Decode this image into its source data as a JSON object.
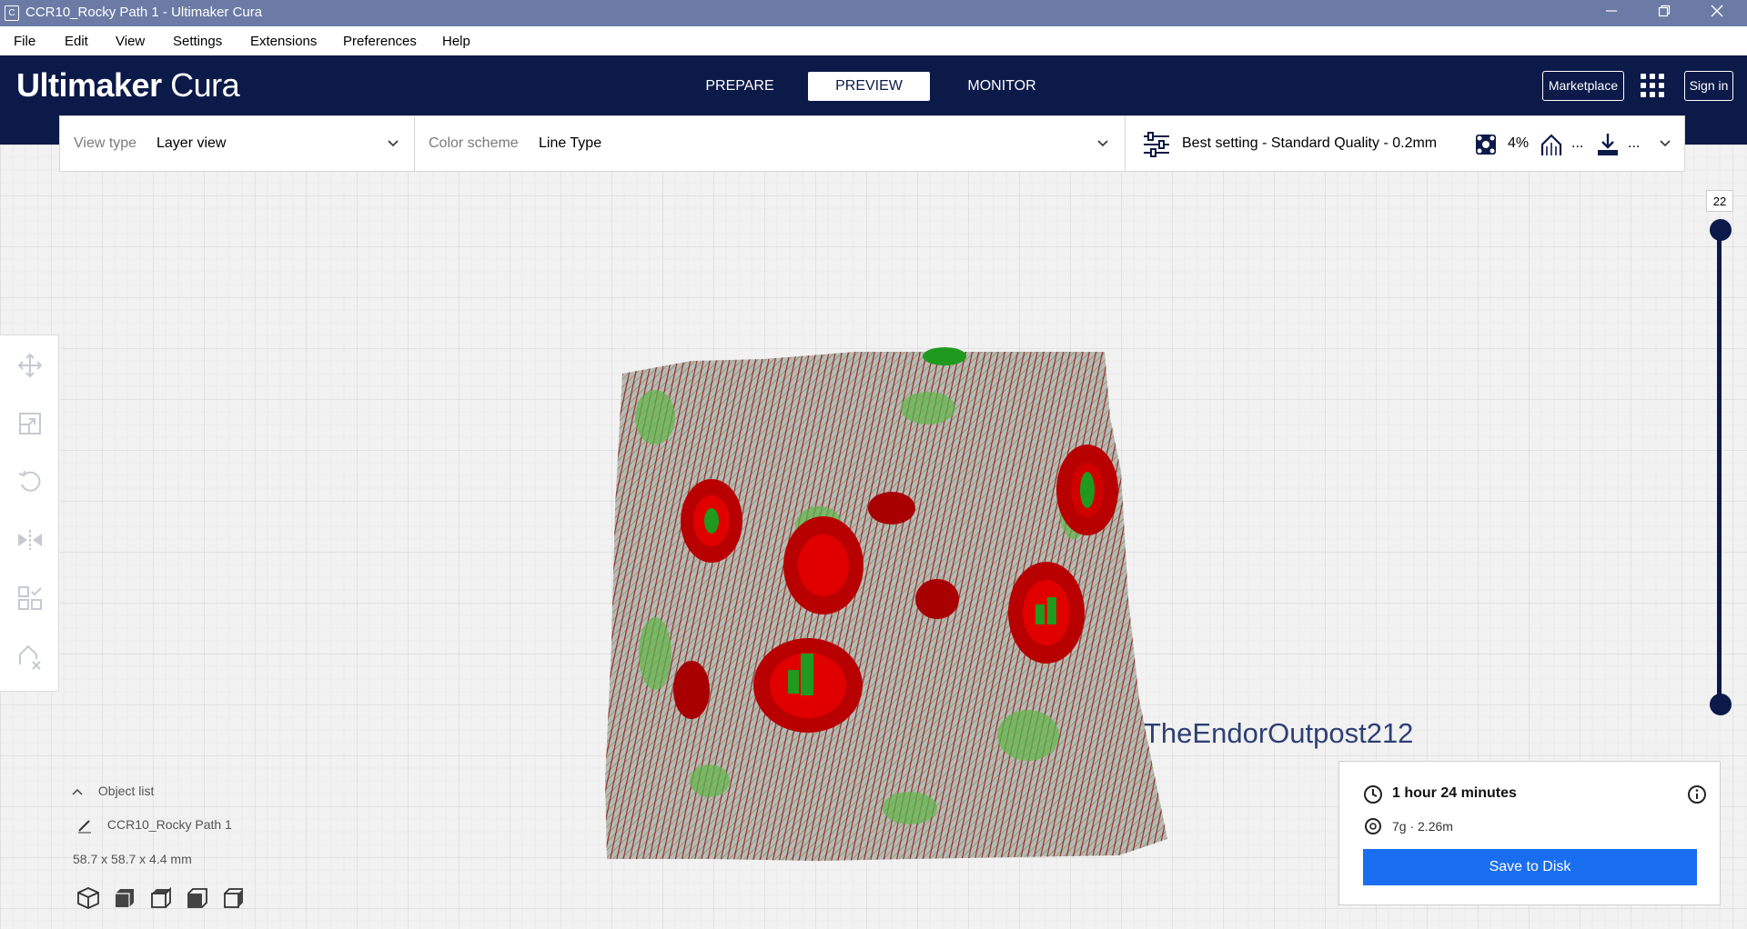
{
  "window": {
    "title": "CCR10_Rocky Path 1 - Ultimaker Cura",
    "app_icon": "C",
    "controls": [
      "minimize-icon",
      "restore-icon",
      "close-icon"
    ]
  },
  "menu": [
    "File",
    "Edit",
    "View",
    "Settings",
    "Extensions",
    "Preferences",
    "Help"
  ],
  "header": {
    "logo_bold": "Ultimaker",
    "logo_light": "Cura",
    "tabs": [
      {
        "label": "PREPARE",
        "active": false
      },
      {
        "label": "PREVIEW",
        "active": true
      },
      {
        "label": "MONITOR",
        "active": false
      }
    ],
    "marketplace": "Marketplace",
    "signin": "Sign in"
  },
  "view_type": {
    "label": "View type",
    "value": "Layer view"
  },
  "color_scheme": {
    "label": "Color scheme",
    "value": "Line Type"
  },
  "print_settings": {
    "profile": "Best setting - Standard Quality - 0.2mm",
    "infill": "4%",
    "support": "...",
    "adhesion": "..."
  },
  "layer_slider": {
    "current_layer": "22"
  },
  "object_list": {
    "header": "Object list",
    "object_name": "CCR10_Rocky Path 1",
    "dimensions": "58.7 x 58.7 x 4.4 mm"
  },
  "print_info": {
    "time": "1 hour 24 minutes",
    "material": "7g · 2.26m",
    "save_label": "Save to Disk"
  },
  "watermark": "TheEndorOutpost212",
  "colors": {
    "header_bg": "#0b1a48",
    "accent_blue": "#196ef0",
    "titlebar": "#6b7ba6",
    "model_wall": "#8b0000",
    "model_infill": "#2fa82f"
  }
}
